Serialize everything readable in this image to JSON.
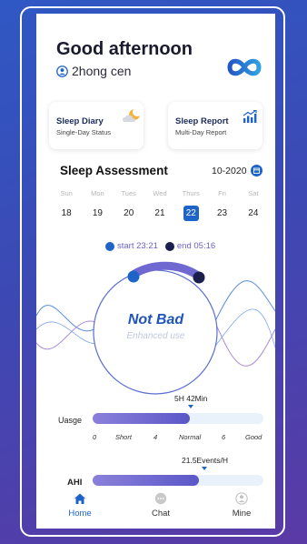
{
  "header": {
    "greeting": "Good afternoon",
    "user_name": "2hong cen"
  },
  "cards": [
    {
      "title": "Sleep Diary",
      "subtitle": "Single-Day Status",
      "icon": "moon-cloud-icon"
    },
    {
      "title": "Sleep Report",
      "subtitle": "Multi-Day Report",
      "icon": "bar-chart-up-icon"
    }
  ],
  "assessment": {
    "title": "Sleep Assessment",
    "month": "10-2020",
    "week": [
      {
        "day": "Sun",
        "date": "18"
      },
      {
        "day": "Mon",
        "date": "19"
      },
      {
        "day": "Tues",
        "date": "20"
      },
      {
        "day": "Wed",
        "date": "21"
      },
      {
        "day": "Thurs",
        "date": "22",
        "selected": true
      },
      {
        "day": "Fri",
        "date": "23"
      },
      {
        "day": "Sat",
        "date": "24"
      }
    ],
    "start_label": "start 23:21",
    "end_label": "end 05:16",
    "result": "Not Bad",
    "result_sub": "Enhanced use"
  },
  "usage": {
    "label": "Uasge",
    "value_text": "5H 42Min",
    "fill_fraction": 0.57,
    "ticks": [
      "0",
      "Short",
      "4",
      "Normal",
      "6",
      "Good"
    ]
  },
  "ahi": {
    "label": "AHI",
    "value_text": "21.5Events/H",
    "fill_fraction": 0.62
  },
  "tabs": [
    {
      "label": "Home",
      "icon": "home-icon",
      "active": true
    },
    {
      "label": "Chat",
      "icon": "chat-icon",
      "active": false
    },
    {
      "label": "Mine",
      "icon": "person-icon",
      "active": false
    }
  ],
  "colors": {
    "accent": "#1e64c8",
    "fill": "#6f68d0",
    "start_dot": "#1e64c8",
    "end_dot": "#1a1f4e"
  }
}
